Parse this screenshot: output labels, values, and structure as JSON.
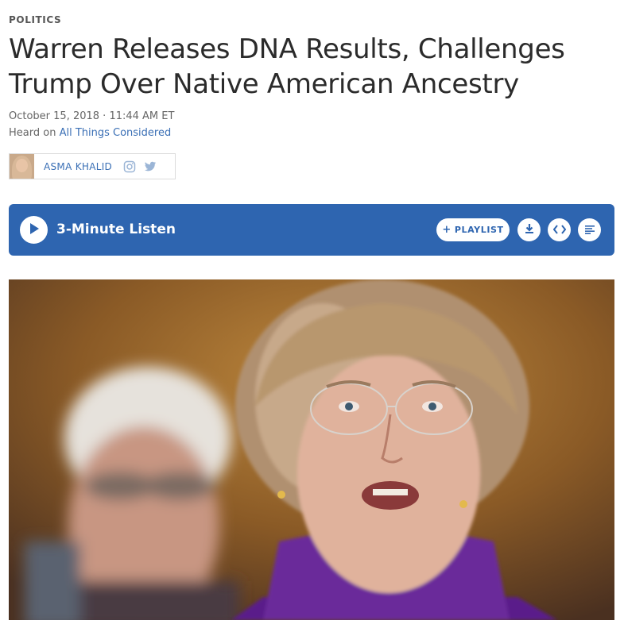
{
  "article": {
    "section": "POLITICS",
    "headline": "Warren Releases DNA Results, Challenges Trump Over Native American Ancestry",
    "dateline": "October 15, 2018 · 11:44 AM ET",
    "heard_prefix": "Heard on",
    "heard_program": "All Things Considered"
  },
  "byline": {
    "author": "ASMA KHALID",
    "icons": [
      "instagram-icon",
      "twitter-icon"
    ]
  },
  "player": {
    "listen_label": "3-Minute Listen",
    "playlist_label": "PLAYLIST",
    "icons": [
      "play-icon",
      "download-icon",
      "embed-icon",
      "transcript-icon"
    ],
    "bg_color": "#2e65b0"
  },
  "photo": {
    "subjects": "Elizabeth Warren speaking in foreground, Bernie Sanders blurred in background"
  }
}
